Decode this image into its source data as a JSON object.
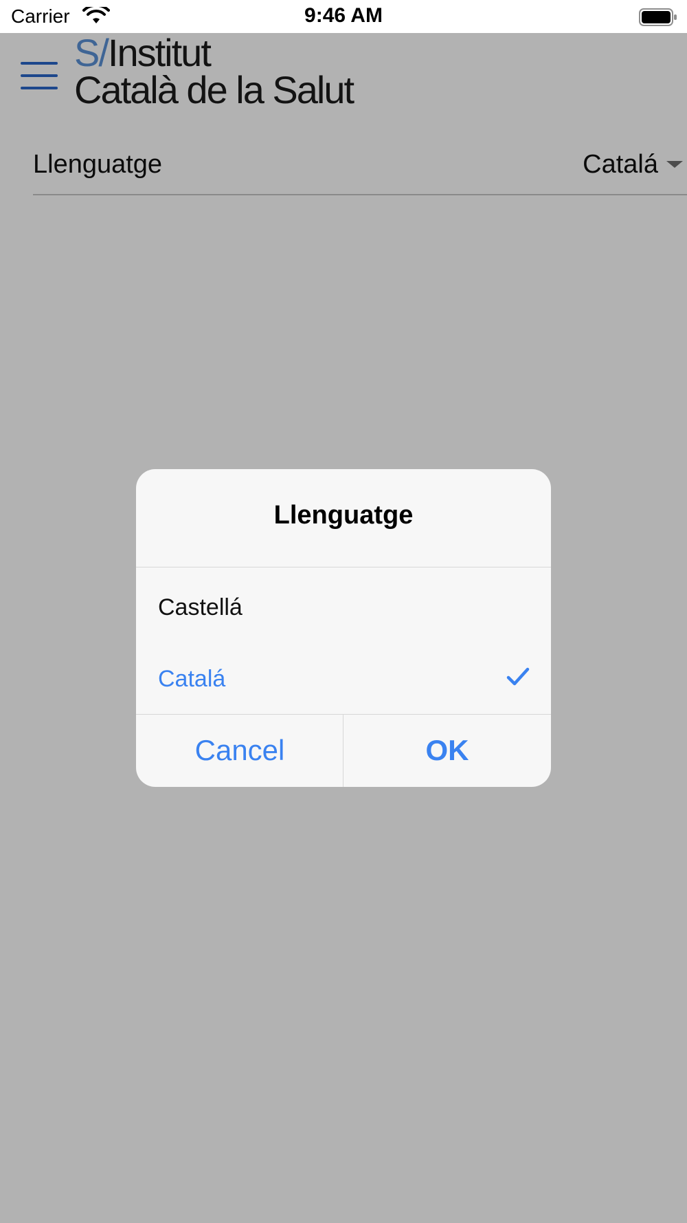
{
  "status_bar": {
    "carrier": "Carrier",
    "time": "9:46 AM",
    "wifi_icon": "wifi-icon",
    "battery_icon": "battery-full-icon"
  },
  "header": {
    "logo_prefix": "S/",
    "logo_line1": "Institut",
    "logo_line2": "Català de la Salut",
    "menu_icon": "hamburger-menu-icon"
  },
  "settings": {
    "language_label": "Llenguatge",
    "language_value": "Catalá"
  },
  "dialog": {
    "title": "Llenguatge",
    "options": [
      {
        "label": "Castellá",
        "selected": false
      },
      {
        "label": "Catalá",
        "selected": true
      }
    ],
    "cancel_label": "Cancel",
    "ok_label": "OK"
  },
  "colors": {
    "accent": "#3a82f0",
    "logo_slash": "#5b91d6",
    "menu_icon": "#2a66c9",
    "overlay": "rgba(0,0,0,0.30)"
  }
}
